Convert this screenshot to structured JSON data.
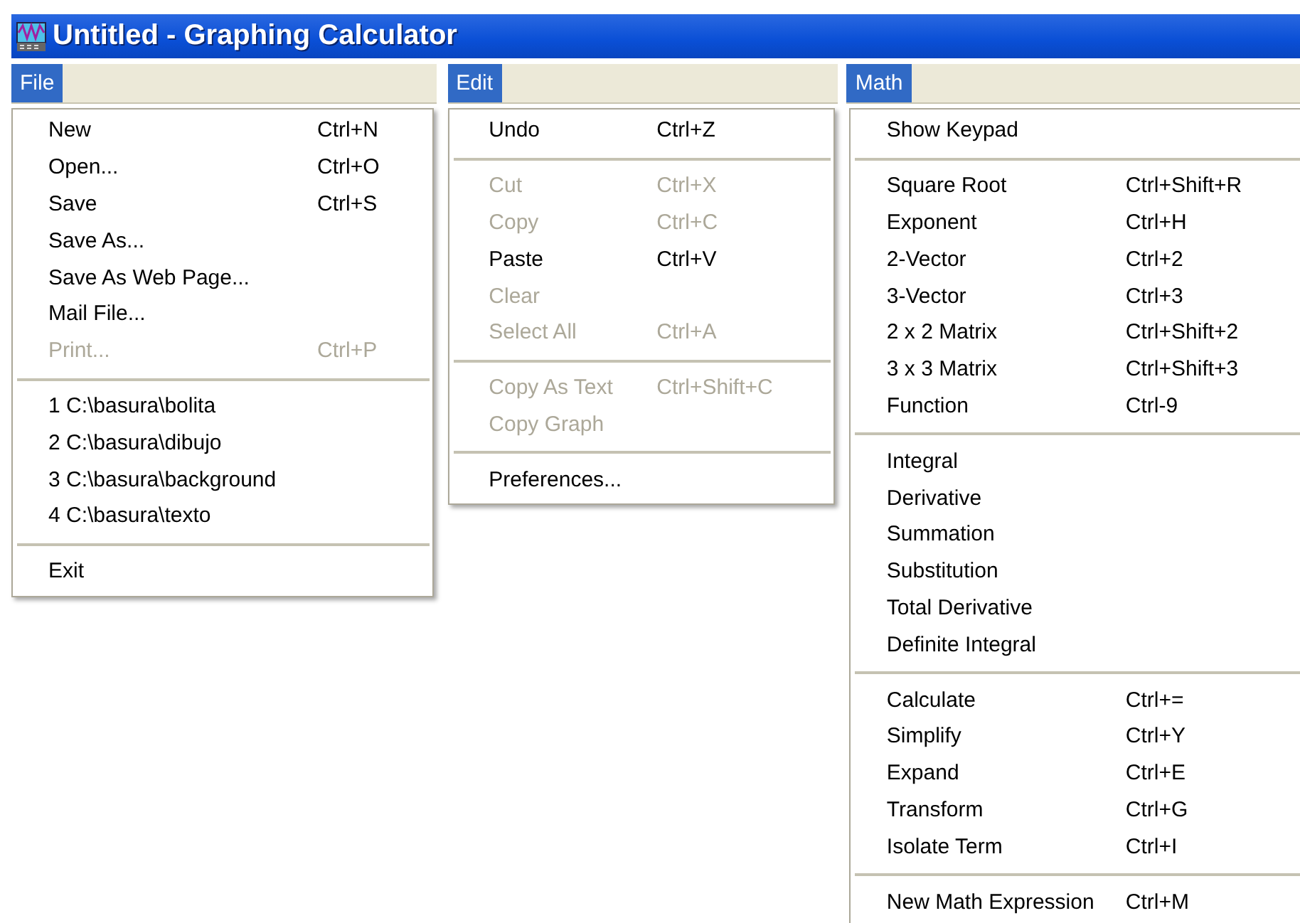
{
  "window": {
    "title": "Untitled - Graphing Calculator"
  },
  "menus": [
    {
      "label": "File",
      "selected": true,
      "groups": [
        [
          {
            "label": "New",
            "shortcut": "Ctrl+N",
            "disabled": false
          },
          {
            "label": "Open...",
            "shortcut": "Ctrl+O",
            "disabled": false
          },
          {
            "label": "Save",
            "shortcut": "Ctrl+S",
            "disabled": false
          },
          {
            "label": "Save As...",
            "disabled": false
          },
          {
            "label": "Save As Web Page...",
            "disabled": false
          },
          {
            "label": "Mail File...",
            "disabled": false
          },
          {
            "label": "Print...",
            "shortcut": "Ctrl+P",
            "disabled": true
          }
        ],
        [
          {
            "label": "1 C:\\basura\\bolita",
            "disabled": false
          },
          {
            "label": "2 C:\\basura\\dibujo",
            "disabled": false
          },
          {
            "label": "3 C:\\basura\\background",
            "disabled": false
          },
          {
            "label": "4 C:\\basura\\texto",
            "disabled": false
          }
        ],
        [
          {
            "label": "Exit",
            "disabled": false
          }
        ]
      ]
    },
    {
      "label": "Edit",
      "selected": true,
      "groups": [
        [
          {
            "label": "Undo",
            "shortcut": "Ctrl+Z",
            "disabled": false
          }
        ],
        [
          {
            "label": "Cut",
            "shortcut": "Ctrl+X",
            "disabled": true
          },
          {
            "label": "Copy",
            "shortcut": "Ctrl+C",
            "disabled": true
          },
          {
            "label": "Paste",
            "shortcut": "Ctrl+V",
            "disabled": false
          },
          {
            "label": "Clear",
            "disabled": true
          },
          {
            "label": "Select All",
            "shortcut": "Ctrl+A",
            "disabled": true
          }
        ],
        [
          {
            "label": "Copy As Text",
            "shortcut": "Ctrl+Shift+C",
            "disabled": true
          },
          {
            "label": "Copy Graph",
            "disabled": true
          }
        ],
        [
          {
            "label": "Preferences...",
            "disabled": false
          }
        ]
      ]
    },
    {
      "label": "Math",
      "selected": true,
      "groups": [
        [
          {
            "label": "Show Keypad",
            "disabled": false
          }
        ],
        [
          {
            "label": "Square Root",
            "shortcut": "Ctrl+Shift+R",
            "disabled": false
          },
          {
            "label": "Exponent",
            "shortcut": "Ctrl+H",
            "disabled": false
          },
          {
            "label": "2-Vector",
            "shortcut": "Ctrl+2",
            "disabled": false
          },
          {
            "label": "3-Vector",
            "shortcut": "Ctrl+3",
            "disabled": false
          },
          {
            "label": "2 x 2 Matrix",
            "shortcut": "Ctrl+Shift+2",
            "disabled": false
          },
          {
            "label": "3 x 3 Matrix",
            "shortcut": "Ctrl+Shift+3",
            "disabled": false
          },
          {
            "label": "Function",
            "shortcut": "Ctrl-9",
            "disabled": false
          }
        ],
        [
          {
            "label": "Integral",
            "disabled": false
          },
          {
            "label": "Derivative",
            "disabled": false
          },
          {
            "label": "Summation",
            "disabled": false
          },
          {
            "label": "Substitution",
            "disabled": false
          },
          {
            "label": "Total Derivative",
            "disabled": false
          },
          {
            "label": "Definite Integral",
            "disabled": false
          }
        ],
        [
          {
            "label": "Calculate",
            "shortcut": "Ctrl+=",
            "disabled": false
          },
          {
            "label": "Simplify",
            "shortcut": "Ctrl+Y",
            "disabled": false
          },
          {
            "label": "Expand",
            "shortcut": "Ctrl+E",
            "disabled": false
          },
          {
            "label": "Transform",
            "shortcut": "Ctrl+G",
            "disabled": false
          },
          {
            "label": "Isolate Term",
            "shortcut": "Ctrl+I",
            "disabled": false
          }
        ],
        [
          {
            "label": "New Math Expression",
            "shortcut": "Ctrl+M",
            "disabled": false
          }
        ]
      ]
    }
  ]
}
